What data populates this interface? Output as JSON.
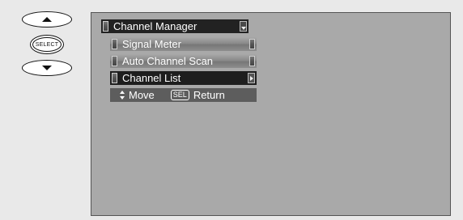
{
  "remote": {
    "up_icon": "triangle-up",
    "select_label": "SELECT",
    "down_icon": "triangle-down"
  },
  "menu": {
    "title": "Channel Manager",
    "items": [
      {
        "label": "Signal Meter"
      },
      {
        "label": "Auto Channel Scan"
      },
      {
        "label": "Channel List"
      }
    ],
    "hint": {
      "move_label": "Move",
      "sel_label": "SEL",
      "return_label": "Return"
    }
  },
  "colors": {
    "screen": "#a9a9a9",
    "title_bar": "#222222",
    "selected_item": "#1e1e1e",
    "hint_bar": "#5d5d5d"
  }
}
